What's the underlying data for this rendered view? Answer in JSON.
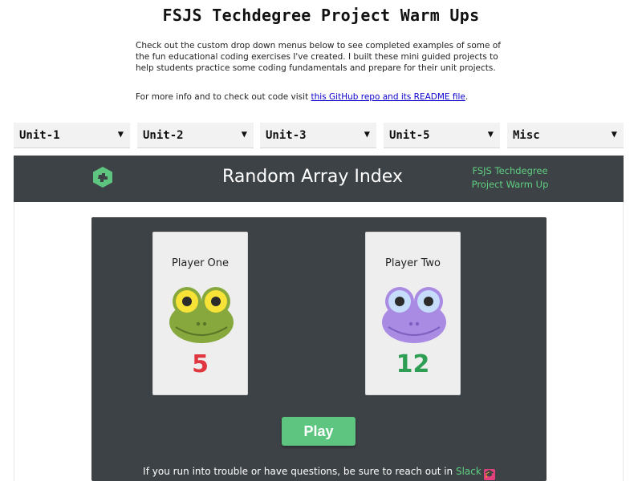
{
  "header": {
    "title": "FSJS Techdegree Project Warm Ups",
    "intro": "Check out the custom drop down menus below to see completed examples of some of the fun educational coding exercises I've created. I built these mini guided projects to help students practice some coding fundamentals and prepare for their unit projects.",
    "info_prefix": "For more info and to check out code visit ",
    "info_link": "this GitHub repo and its README file",
    "info_suffix": "."
  },
  "dropdowns": [
    {
      "label": "Unit-1",
      "arrow": "▼"
    },
    {
      "label": "Unit-2",
      "arrow": "▼"
    },
    {
      "label": "Unit-3",
      "arrow": "▼"
    },
    {
      "label": "Unit-5",
      "arrow": "▼"
    },
    {
      "label": "Misc",
      "arrow": "▼"
    }
  ],
  "app": {
    "logo_icon": "treehouse-logo-icon",
    "title": "Random Array Index",
    "subtitle_line1": "FSJS Techdegree",
    "subtitle_line2": "Project Warm Up"
  },
  "players": [
    {
      "name": "Player One",
      "score": "5",
      "frog_color": "#86a83c",
      "eye_color": "#f7e238",
      "score_color": "#e0363f"
    },
    {
      "name": "Player Two",
      "score": "12",
      "frog_color": "#a98be4",
      "eye_color": "#c6dcfb",
      "score_color": "#2e9e55"
    }
  ],
  "play_label": "Play",
  "footer": {
    "text": "If you run into trouble or have questions, be sure to reach out in ",
    "slack_label": "Slack",
    "cap_icon": "graduation-cap-icon"
  },
  "colors": {
    "dark_bg": "#3d4247",
    "accent_green": "#5dc57f",
    "link_blue": "#0b00cc"
  }
}
